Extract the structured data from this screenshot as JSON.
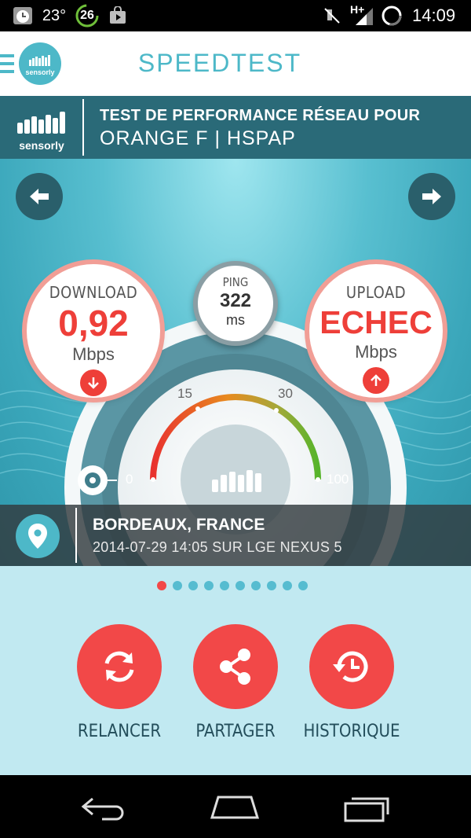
{
  "status_bar": {
    "temperature": "23°",
    "notification_count": "26",
    "network_type": "H+",
    "time": "14:09",
    "icons": [
      "alarm-icon",
      "temperature-icon",
      "badge-icon",
      "store-icon",
      "mute-icon",
      "signal-icon",
      "sync-icon"
    ]
  },
  "app_bar": {
    "title": "SPEEDTEST",
    "logo_text": "sensorly"
  },
  "banner": {
    "logo_text": "sensorly",
    "line1": "TEST DE PERFORMANCE RÉSEAU POUR",
    "line2": "ORANGE F | HSPAP"
  },
  "results": {
    "download": {
      "label": "DOWNLOAD",
      "value": "0,92",
      "unit": "Mbps"
    },
    "upload": {
      "label": "UPLOAD",
      "value": "ECHEC",
      "unit": "Mbps"
    },
    "ping": {
      "label": "PING",
      "value": "322",
      "unit": "ms"
    }
  },
  "gauge": {
    "ticks": [
      "0",
      "15",
      "30",
      "100"
    ],
    "colors": {
      "red": "#e8322e",
      "orange": "#e88a1f",
      "green": "#56b42a"
    }
  },
  "location": {
    "city": "BORDEAUX, FRANCE",
    "date": "2014-07-29 14:05 SUR LGE NEXUS 5"
  },
  "pager": {
    "count": 10,
    "active": 0
  },
  "actions": [
    {
      "label": "RELANCER",
      "icon": "refresh-icon"
    },
    {
      "label": "PARTAGER",
      "icon": "share-icon"
    },
    {
      "label": "HISTORIQUE",
      "icon": "history-icon"
    }
  ],
  "colors": {
    "accent": "#f24848",
    "teal": "#4db8c8",
    "banner": "#2a6a78",
    "lower_bg": "#c1e9f1"
  }
}
